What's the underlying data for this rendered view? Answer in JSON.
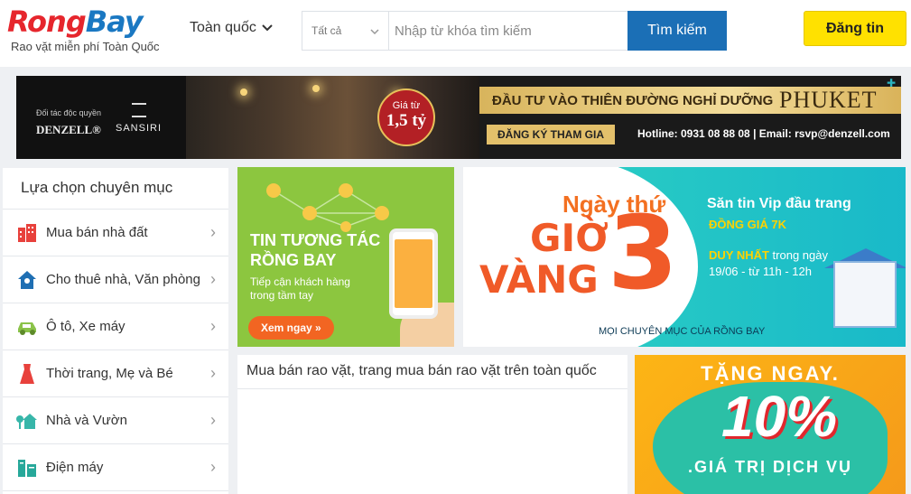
{
  "header": {
    "logo_part1": "Rong",
    "logo_part2": "Bay",
    "logo_tagline": "Rao vặt miễn phí Toàn Quốc",
    "region": "Toàn quốc",
    "search_category": "Tất cả",
    "search_placeholder": "Nhập từ khóa tìm kiếm",
    "search_button": "Tìm kiếm",
    "post_button": "Đăng tin"
  },
  "top_banner": {
    "partner": "Đối tác độc quyền",
    "brand1": "DENZELL®",
    "brand2": "SANSIRI",
    "price_prefix": "Giá từ",
    "price": "1,5 tỷ",
    "headline": "ĐẦU TƯ VÀO THIÊN ĐƯỜNG NGHỈ DƯỠNG",
    "headline_place": "PHUKET",
    "cta": "ĐĂNG KÝ THAM GIA",
    "contact": "Hotline: 0931 08 88 08  |  Email: rsvp@denzell.com"
  },
  "sidebar": {
    "title": "Lựa chọn chuyên mục",
    "items": [
      {
        "label": "Mua bán nhà đất",
        "icon": "building-icon",
        "color": "#e8413c"
      },
      {
        "label": "Cho thuê nhà, Văn phòng",
        "icon": "house-icon",
        "color": "#1f6fb3"
      },
      {
        "label": "Ô tô, Xe máy",
        "icon": "car-icon",
        "color": "#8bc34a"
      },
      {
        "label": "Thời trang, Mẹ và Bé",
        "icon": "dress-icon",
        "color": "#e8413c"
      },
      {
        "label": "Nhà và Vườn",
        "icon": "garden-house-icon",
        "color": "#37b6a9"
      },
      {
        "label": "Điện máy",
        "icon": "appliance-icon",
        "color": "#27a89a"
      }
    ]
  },
  "green_banner": {
    "title_line1": "TIN TƯƠNG TÁC",
    "title_line2": "RỒNG BAY",
    "sub_line1": "Tiếp cận khách hàng",
    "sub_line2": "trong tầm tay",
    "button": "Xem ngay »"
  },
  "teal_banner": {
    "day": "Ngày thứ",
    "gio": "GIỜ",
    "vang": "VÀNG",
    "number": "3",
    "head": "Săn tin Vip đầu trang",
    "price": "ĐỒNG GIÁ 7K",
    "only_hl": "DUY NHẤT",
    "only_rest": " trong ngày",
    "time": "19/06 - từ 11h - 12h",
    "footer": "MỌI CHUYÊN MỤC CỦA RỒNG BAY"
  },
  "content": {
    "title": "Mua bán rao vặt, trang mua bán rao vặt trên toàn quốc"
  },
  "orange_banner": {
    "head": "TẶNG NGAY.",
    "percent": "10%",
    "foot": ".GIÁ TRỊ DỊCH VỤ"
  },
  "colors": {
    "brand_red": "#e6262d",
    "brand_blue": "#1a78c2",
    "search_button": "#1b6fb6",
    "post_button": "#ffe100"
  }
}
